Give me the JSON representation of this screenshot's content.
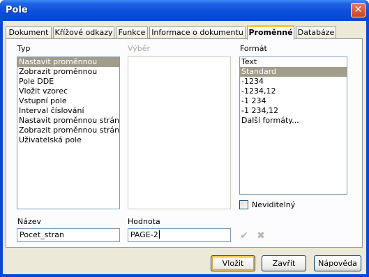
{
  "window": {
    "title": "Pole",
    "close_glyph": "✕"
  },
  "tabs": [
    {
      "label": "Dokument"
    },
    {
      "label": "Křížové odkazy"
    },
    {
      "label": "Funkce"
    },
    {
      "label": "Informace o dokumentu"
    },
    {
      "label": "Proměnné",
      "active": true
    },
    {
      "label": "Databáze"
    }
  ],
  "type_section": {
    "label": "Typ",
    "items": [
      "Nastavit proměnnou",
      "Zobrazit proměnnou",
      "Pole DDE",
      "Vložit vzorec",
      "Vstupní pole",
      "Interval číslování",
      "Nastavit proměnnou stránky",
      "Zobrazit proměnnou stránky",
      "Uživatelská pole"
    ],
    "selected": "Nastavit proměnnou"
  },
  "selection_section": {
    "label": "Výběr",
    "items": []
  },
  "format_section": {
    "label": "Formát",
    "items": [
      "Text",
      "Standard",
      "-1234",
      "-1234,12",
      "-1 234",
      "-1 234,12",
      "Další formáty..."
    ],
    "selected": "Standard"
  },
  "invisible_checkbox": {
    "label": "Neviditelný",
    "checked": false
  },
  "name_field": {
    "label": "Název",
    "value": "Pocet_stran"
  },
  "value_field": {
    "label": "Hodnota",
    "value": "PAGE-2"
  },
  "icons": {
    "apply": "check-icon",
    "delete": "delete-icon",
    "apply_glyph": "✔",
    "delete_glyph": "✖"
  },
  "buttons": {
    "insert": "Vložit",
    "close": "Zavřít",
    "help": "Nápověda"
  }
}
